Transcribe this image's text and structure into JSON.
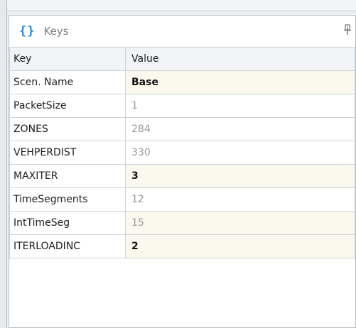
{
  "panel": {
    "icon": "curly-braces-icon",
    "icon_glyph": "{}",
    "title": "Keys",
    "pin_icon": "pin-icon"
  },
  "grid": {
    "columns": [
      "Key",
      "Value"
    ],
    "rows": [
      {
        "key": "Scen. Name",
        "value": "Base",
        "style": "bold"
      },
      {
        "key": "PacketSize",
        "value": "1",
        "style": "grey"
      },
      {
        "key": "ZONES",
        "value": "284",
        "style": "grey"
      },
      {
        "key": "VEHPERDIST",
        "value": "330",
        "style": "grey"
      },
      {
        "key": "MAXITER",
        "value": "3",
        "style": "bold"
      },
      {
        "key": "TimeSegments",
        "value": "12",
        "style": "grey"
      },
      {
        "key": "IntTimeSeg",
        "value": "15",
        "style": "grey-tinted"
      },
      {
        "key": "ITERLOADINC",
        "value": "2",
        "style": "bold"
      }
    ]
  },
  "colors": {
    "accent": "#2f86d6",
    "highlight_row": "#fbf8ee"
  }
}
